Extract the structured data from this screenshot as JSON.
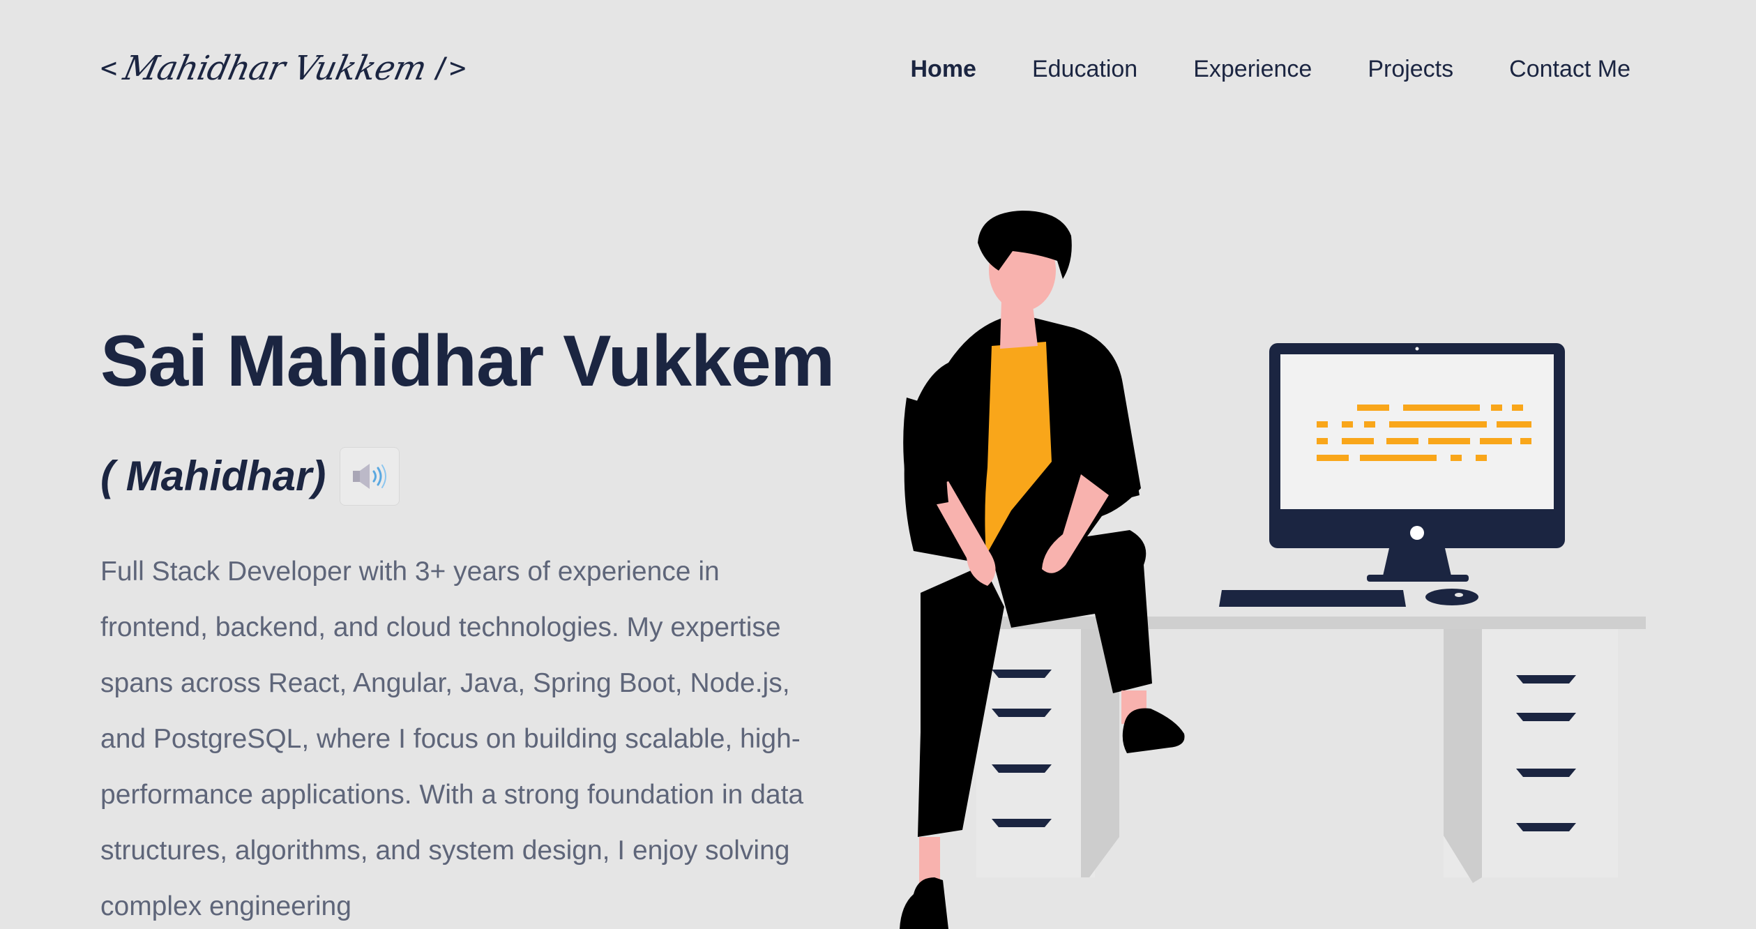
{
  "header": {
    "logo": {
      "open_bracket": "<",
      "signature": "Mahidhar Vukkem",
      "close_bracket": "/>"
    },
    "nav": [
      {
        "label": "Home",
        "active": true
      },
      {
        "label": "Education",
        "active": false
      },
      {
        "label": "Experience",
        "active": false
      },
      {
        "label": "Projects",
        "active": false
      },
      {
        "label": "Contact Me",
        "active": false
      }
    ]
  },
  "hero": {
    "title": "Sai Mahidhar Vukkem",
    "nickname": "( Mahidhar)",
    "speaker_icon": "speaker-icon",
    "bio": "Full Stack Developer with 3+ years of experience in frontend, backend, and cloud technologies. My expertise spans across React, Angular, Java, Spring Boot, Node.js, and PostgreSQL, where I focus on building scalable, high-performance applications. With a strong foundation in data structures, algorithms, and system design, I enjoy solving complex engineering"
  },
  "colors": {
    "background": "#e5e5e5",
    "navy": "#1b2541",
    "accent": "#f9a61a",
    "text_muted": "#5e6579"
  }
}
